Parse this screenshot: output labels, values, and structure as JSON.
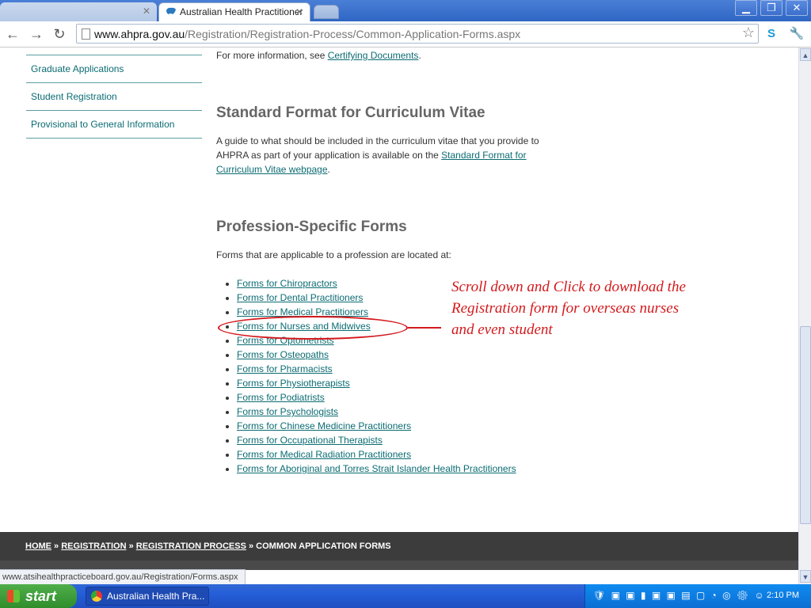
{
  "browser": {
    "tabs": [
      {
        "label": "",
        "active": false
      },
      {
        "label": "Australian Health Practitioner",
        "active": true
      }
    ],
    "url_domain": "www.ahpra.gov.au",
    "url_path": "/Registration/Registration-Process/Common-Application-Forms.aspx",
    "status_url": "www.atsihealthpracticeboard.gov.au/Registration/Forms.aspx"
  },
  "sidebar": {
    "items": [
      {
        "label": "Graduate Applications"
      },
      {
        "label": "Student Registration"
      },
      {
        "label": "Provisional to General Information"
      }
    ]
  },
  "content": {
    "more_info_prefix": "For more information, see ",
    "more_info_link": "Certifying Documents",
    "more_info_suffix": ".",
    "cv_heading": "Standard Format for Curriculum Vitae",
    "cv_line1": "A guide to what should be included in the curriculum vitae that you provide to",
    "cv_line2_prefix": "AHPRA as part of your application is available on the ",
    "cv_link_line1": "Standard Format for",
    "cv_link_line2": "Curriculum Vitae webpage",
    "cv_suffix": ".",
    "forms_heading": "Profession-Specific Forms",
    "forms_intro": "Forms that are applicable to a profession are located at:",
    "forms": [
      "Forms for Chiropractors",
      "Forms  for Dental Practitioners ",
      "Forms for Medical Practitioners",
      "Forms  for Nurses and Midwives",
      "Forms  for Optometrists ",
      "Forms  for Osteopaths",
      "Forms for Pharmacists ",
      "Forms  for Physiotherapists",
      "Forms for Podiatrists ",
      "Forms for Psychologists",
      "Forms for Chinese Medicine Practitioners",
      "Forms for Occupational Therapists",
      "Forms for Medical Radiation Practitioners",
      "Forms for Aboriginal and Torres Strait Islander Health Practitioners"
    ]
  },
  "annotation": {
    "text": "Scroll down and Click to download the Registration form for overseas nurses and even student",
    "color": "#d4191c"
  },
  "breadcrumb": {
    "home": "HOME",
    "sep": " » ",
    "registration": "REGISTRATION",
    "process": "REGISTRATION PROCESS",
    "current": "COMMON APPLICATION FORMS"
  },
  "taskbar": {
    "start": "start",
    "task_label": "Australian Health Pra...",
    "clock": "2:10 PM"
  }
}
